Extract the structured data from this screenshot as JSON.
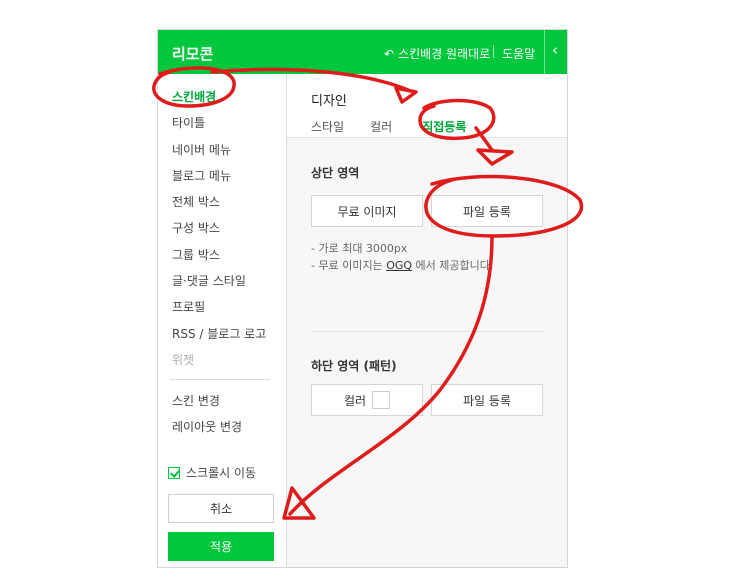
{
  "header": {
    "title": "리모콘",
    "reset_label": "스킨배경 원래대로",
    "help_label": "도움말",
    "collapse_icon": "‹"
  },
  "sidebar": {
    "items": [
      {
        "label": "스킨배경"
      },
      {
        "label": "타이틀"
      },
      {
        "label": "네이버 메뉴"
      },
      {
        "label": "블로그 메뉴"
      },
      {
        "label": "전체 박스"
      },
      {
        "label": "구성 박스"
      },
      {
        "label": "그룹 박스"
      },
      {
        "label": "글·댓글 스타일"
      },
      {
        "label": "프로필"
      },
      {
        "label": "RSS / 블로그 로고"
      },
      {
        "label": "위젯"
      }
    ],
    "extra_items": [
      {
        "label": "스킨 변경"
      },
      {
        "label": "레이아웃 변경"
      }
    ],
    "scroll_label": "스크롤시 이동",
    "cancel_label": "취소",
    "apply_label": "적용"
  },
  "content": {
    "section_title": "디자인",
    "tabs": [
      {
        "label": "스타일"
      },
      {
        "label": "컬러"
      },
      {
        "label": "직접등록"
      }
    ],
    "top_area": {
      "label": "상단 영역",
      "free_image_btn": "무료 이미지",
      "file_btn": "파일 등록",
      "note1": "- 가로 최대 3000px",
      "note2_prefix": "- 무료 이미지는 ",
      "note2_link": "OGQ",
      "note2_suffix": " 에서 제공합니다."
    },
    "bottom_area": {
      "label": "하단 영역 (패턴)",
      "color_btn": "컬러",
      "file_btn": "파일 등록"
    }
  },
  "colors": {
    "accent": "#00c73c",
    "annotation": "#e01b1b"
  }
}
